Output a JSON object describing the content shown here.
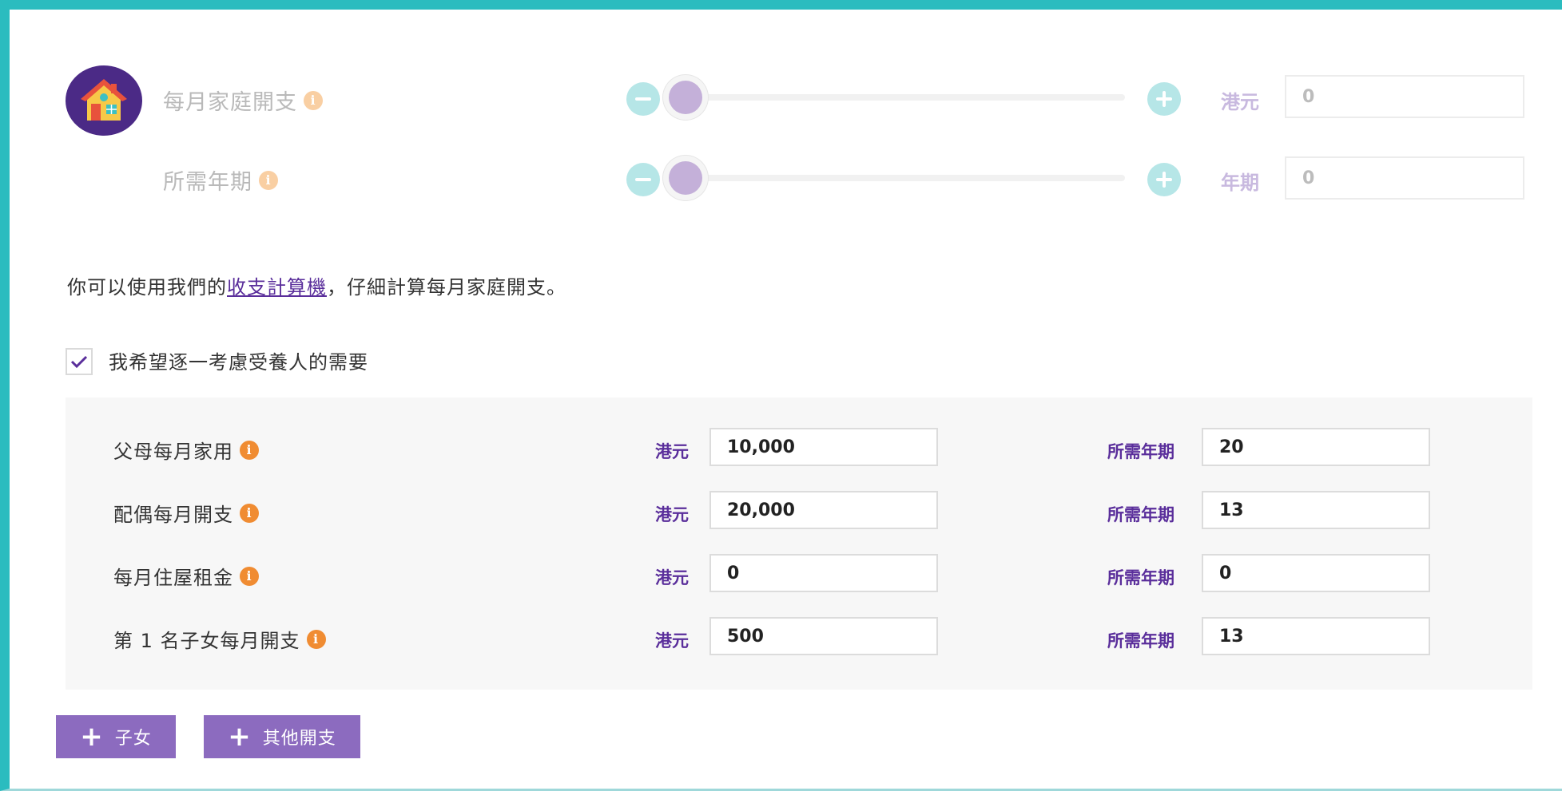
{
  "monthly_expense": {
    "label": "每月家庭開支",
    "unit": "港元",
    "value": "0",
    "slider_level": 0
  },
  "duration": {
    "label": "所需年期",
    "unit": "年期",
    "value": "0",
    "slider_level": 0
  },
  "note": {
    "prefix": "你可以使用我們的",
    "link": "收支計算機",
    "suffix": "，仔細計算每月家庭開支。"
  },
  "dependents_checkbox": {
    "label": "我希望逐一考慮受養人的需要",
    "checked": true
  },
  "rows": [
    {
      "label": "父母每月家用",
      "currency_unit": "港元",
      "amount": "10,000",
      "years_label": "所需年期",
      "years": "20"
    },
    {
      "label": "配偶每月開支",
      "currency_unit": "港元",
      "amount": "20,000",
      "years_label": "所需年期",
      "years": "13"
    },
    {
      "label": "每月住屋租金",
      "currency_unit": "港元",
      "amount": "0",
      "years_label": "所需年期",
      "years": "0"
    },
    {
      "label": "第 1 名子女每月開支",
      "currency_unit": "港元",
      "amount": "500",
      "years_label": "所需年期",
      "years": "13"
    }
  ],
  "buttons": {
    "add_child": "子女",
    "add_other": "其他開支"
  },
  "colors": {
    "frame": "#2bbcbf",
    "accent_purple": "#5a2e9b",
    "button_purple": "#8c6bbf",
    "info_orange": "#f08c32"
  }
}
